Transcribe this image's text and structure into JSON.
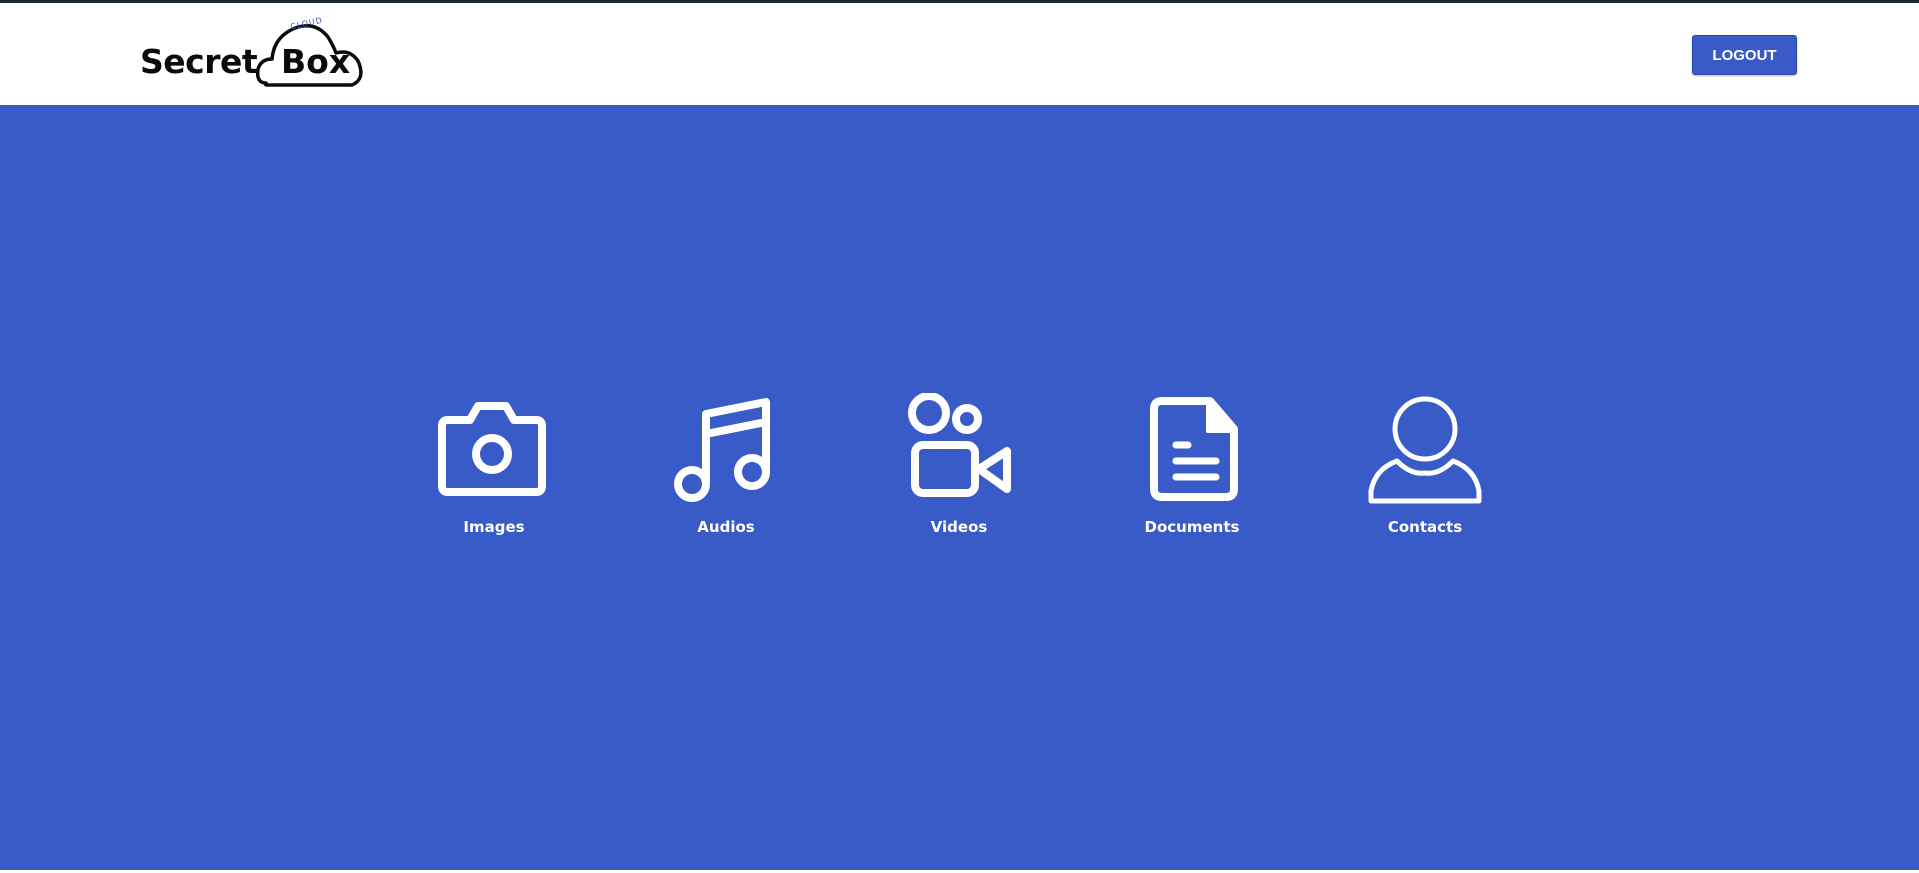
{
  "header": {
    "logo": {
      "word1": "Secret",
      "word2": "Box",
      "tag": "CLOUD"
    },
    "logout_label": "LOGOUT"
  },
  "categories": [
    {
      "label": "Images",
      "icon": "camera-icon"
    },
    {
      "label": "Audios",
      "icon": "music-note-icon"
    },
    {
      "label": "Videos",
      "icon": "video-camera-icon"
    },
    {
      "label": "Documents",
      "icon": "document-icon"
    },
    {
      "label": "Contacts",
      "icon": "user-icon"
    }
  ],
  "colors": {
    "accent": "#395bc8",
    "button": "#3a5bc7",
    "icon": "#ffffff"
  }
}
